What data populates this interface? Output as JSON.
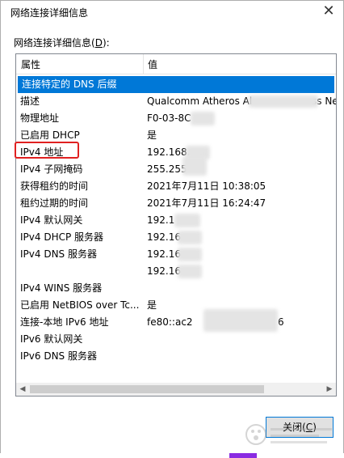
{
  "window": {
    "title": "网络连接详细信息",
    "close_glyph": "✕"
  },
  "section": {
    "label_prefix": "网络连接详细信息(",
    "label_key": "D",
    "label_suffix": "):"
  },
  "table": {
    "header": {
      "property": "属性",
      "value": "值"
    },
    "rows": [
      {
        "property": "连接特定的 DNS 后缀",
        "value": ""
      },
      {
        "property": "描述",
        "value": "Qualcomm Atheros Al",
        "value_tail": "ss Ne"
      },
      {
        "property": "物理地址",
        "value": "F0-03-8C"
      },
      {
        "property": "已启用 DHCP",
        "value": "是"
      },
      {
        "property": "IPv4 地址",
        "value": "192.168."
      },
      {
        "property": "IPv4 子网掩码",
        "value": "255.255"
      },
      {
        "property": "获得租约的时间",
        "value": "2021年7月11日 10:38:05"
      },
      {
        "property": "租约过期的时间",
        "value": "2021年7月11日 16:24:47"
      },
      {
        "property": "IPv4 默认网关",
        "value": "192.1"
      },
      {
        "property": "IPv4 DHCP 服务器",
        "value": "192.16"
      },
      {
        "property": "IPv4 DNS 服务器",
        "value": "192.16"
      },
      {
        "property": "",
        "value": "192.16"
      },
      {
        "property": "IPv4 WINS 服务器",
        "value": ""
      },
      {
        "property": "已启用 NetBIOS over Tc...",
        "value": "是"
      },
      {
        "property": "连接-本地 IPv6 地址",
        "value": "fe80::ac2",
        "value_tail": "6"
      },
      {
        "property": "IPv6 默认网关",
        "value": ""
      },
      {
        "property": "IPv6 DNS 服务器",
        "value": ""
      }
    ]
  },
  "footer": {
    "close_label_prefix": "关闭(",
    "close_label_key": "C",
    "close_label_suffix": ")"
  },
  "colors": {
    "selection": "#0078d7",
    "highlight_border": "#e02020",
    "taskbar_accent": "#8a2be2"
  }
}
